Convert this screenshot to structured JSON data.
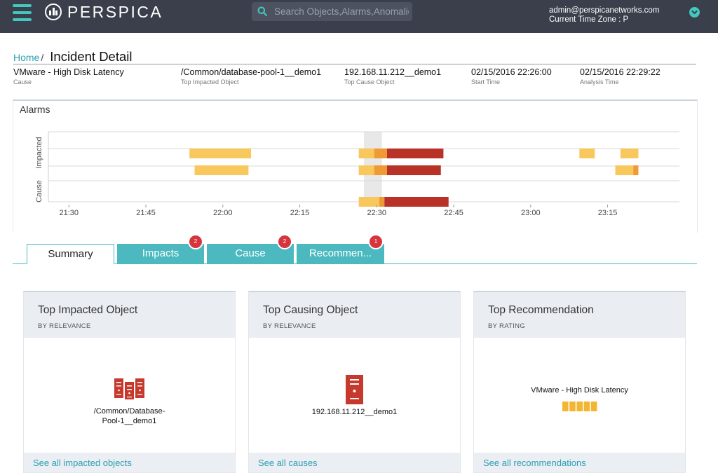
{
  "header": {
    "logo": "PERSPICA",
    "search_placeholder": "Search Objects,Alarms,Anomalies",
    "user_email": "admin@perspicanetworks.com",
    "timezone": "Current Time Zone : P"
  },
  "breadcrumb": {
    "home": "Home",
    "separator": "/",
    "title": "Incident Detail"
  },
  "incident": [
    {
      "value": "VMware - High Disk Latency",
      "label": "Cause"
    },
    {
      "value": "/Common/database-pool-1__demo1",
      "label": "Top Impacted Object"
    },
    {
      "value": "192.168.11.212__demo1",
      "label": "Top Cause Object"
    },
    {
      "value": "02/15/2016 22:26:00",
      "label": "Start Time"
    },
    {
      "value": "02/15/2016 22:29:22",
      "label": "Analysis Time"
    }
  ],
  "alarms": {
    "title": "Alarms",
    "y_labels": [
      "Impacted",
      "Cause"
    ],
    "x_ticks": [
      "21:30",
      "21:45",
      "22:00",
      "22:15",
      "22:30",
      "22:45",
      "23:00",
      "23:15"
    ],
    "tick_minutes": [
      0,
      15,
      30,
      45,
      60,
      75,
      90,
      105
    ],
    "x_range_minutes": [
      -4,
      119
    ],
    "incident_window_minutes": [
      57.5,
      61
    ],
    "colors": {
      "low": "#f9c85c",
      "medium": "#ef9a35",
      "high": "#b93228",
      "window": "#e8e8e8",
      "grid": "#d8d8d8"
    },
    "rows": [
      {
        "group": "Impacted",
        "segments": [
          {
            "start": 23.5,
            "end": 35.5,
            "severity": "low"
          },
          {
            "start": 56.5,
            "end": 59.5,
            "severity": "low"
          },
          {
            "start": 59.5,
            "end": 62,
            "severity": "medium"
          },
          {
            "start": 62,
            "end": 73,
            "severity": "high"
          },
          {
            "start": 99.5,
            "end": 102.5,
            "severity": "low"
          },
          {
            "start": 107.5,
            "end": 111,
            "severity": "low"
          }
        ]
      },
      {
        "group": "Impacted",
        "segments": [
          {
            "start": 24.5,
            "end": 35,
            "severity": "low"
          },
          {
            "start": 56.5,
            "end": 59.5,
            "severity": "low"
          },
          {
            "start": 59.5,
            "end": 62,
            "severity": "medium"
          },
          {
            "start": 62,
            "end": 72.5,
            "severity": "high"
          },
          {
            "start": 106.5,
            "end": 110,
            "severity": "low"
          },
          {
            "start": 110,
            "end": 111,
            "severity": "medium"
          }
        ]
      },
      {
        "group": "Cause",
        "segments": [
          {
            "start": 56.5,
            "end": 60.5,
            "severity": "low"
          },
          {
            "start": 60.5,
            "end": 61.5,
            "severity": "medium"
          },
          {
            "start": 61.5,
            "end": 74,
            "severity": "high"
          }
        ]
      }
    ]
  },
  "tabs": [
    {
      "label": "Summary",
      "badge": ""
    },
    {
      "label": "Impacts",
      "badge": "2"
    },
    {
      "label": "Cause",
      "badge": "2"
    },
    {
      "label": "Recommen...",
      "badge": "1"
    }
  ],
  "cards": [
    {
      "title": "Top Impacted Object",
      "subtitle": "BY RELEVANCE",
      "object_line1": "/Common/Database-",
      "object_line2": "Pool-1__demo1",
      "icon": "server-pool-icon",
      "link": "See all impacted objects"
    },
    {
      "title": "Top Causing Object",
      "subtitle": "BY RELEVANCE",
      "object_line1": "192.168.11.212__demo1",
      "object_line2": "",
      "icon": "server-icon",
      "link": "See all causes"
    },
    {
      "title": "Top Recommendation",
      "subtitle": "BY RATING",
      "object_line1": "VMware - High Disk Latency",
      "object_line2": "",
      "icon": "rating-bar-icon",
      "rating": 5,
      "rating_max": 5,
      "link": "See all recommendations"
    }
  ],
  "icon_colors": {
    "object": "#c63a2e",
    "rating": "#f2b632",
    "accent": "#43c8bd",
    "link": "#2a9fb5"
  }
}
